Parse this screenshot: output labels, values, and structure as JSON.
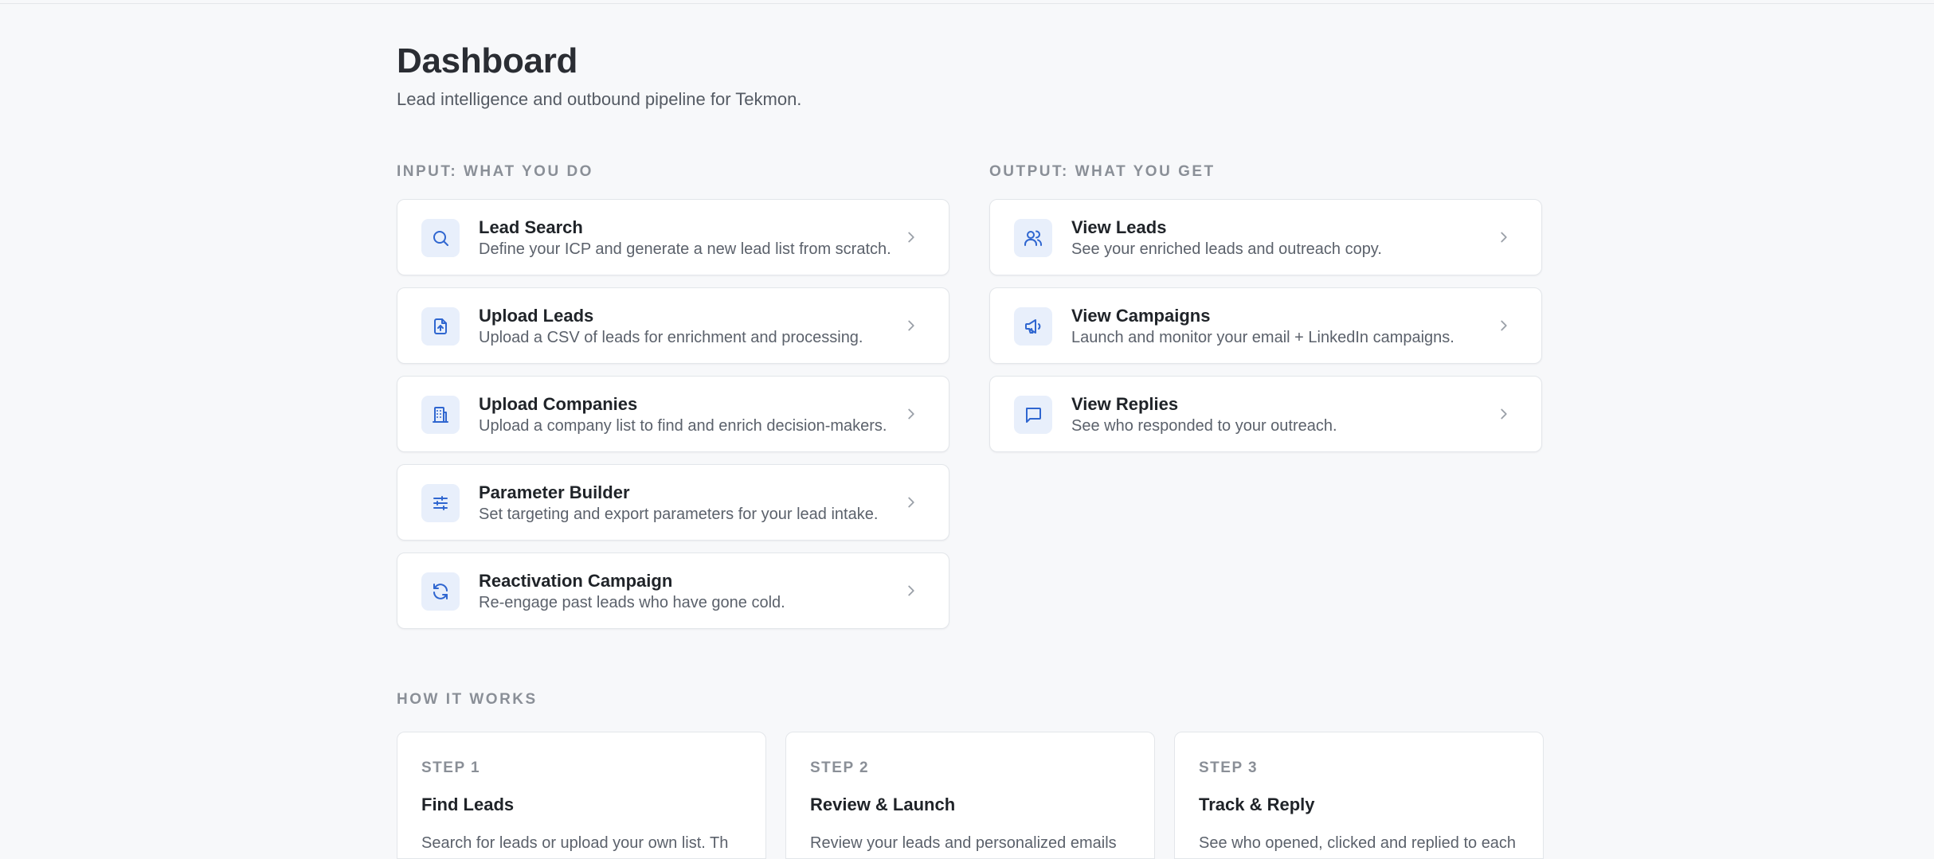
{
  "header": {
    "title": "Dashboard",
    "subtitle": "Lead intelligence and outbound pipeline for Tekmon."
  },
  "input_section": {
    "label": "INPUT: WHAT YOU DO",
    "items": [
      {
        "title": "Lead Search",
        "desc": "Define your ICP and generate a new lead list from scratch.",
        "icon": "search-icon"
      },
      {
        "title": "Upload Leads",
        "desc": "Upload a CSV of leads for enrichment and processing.",
        "icon": "file-upload-icon"
      },
      {
        "title": "Upload Companies",
        "desc": "Upload a company list to find and enrich decision-makers.",
        "icon": "building-icon"
      },
      {
        "title": "Parameter Builder",
        "desc": "Set targeting and export parameters for your lead intake.",
        "icon": "sliders-icon"
      },
      {
        "title": "Reactivation Campaign",
        "desc": "Re-engage past leads who have gone cold.",
        "icon": "refresh-icon"
      }
    ]
  },
  "output_section": {
    "label": "OUTPUT: WHAT YOU GET",
    "items": [
      {
        "title": "View Leads",
        "desc": "See your enriched leads and outreach copy.",
        "icon": "users-icon"
      },
      {
        "title": "View Campaigns",
        "desc": "Launch and monitor your email + LinkedIn campaigns.",
        "icon": "megaphone-icon"
      },
      {
        "title": "View Replies",
        "desc": "See who responded to your outreach.",
        "icon": "message-icon"
      }
    ]
  },
  "how_it_works": {
    "label": "HOW IT WORKS",
    "steps": [
      {
        "num": "STEP 1",
        "title": "Find Leads",
        "text": "Search for leads or upload your own list. Th"
      },
      {
        "num": "STEP 2",
        "title": "Review & Launch",
        "text": "Review your leads and personalized emails"
      },
      {
        "num": "STEP 3",
        "title": "Track & Reply",
        "text": "See who opened, clicked and replied to each"
      }
    ]
  },
  "colors": {
    "accent": "#2f66d0",
    "icon_bg": "#e8effb",
    "page_bg": "#f7f8fa"
  }
}
